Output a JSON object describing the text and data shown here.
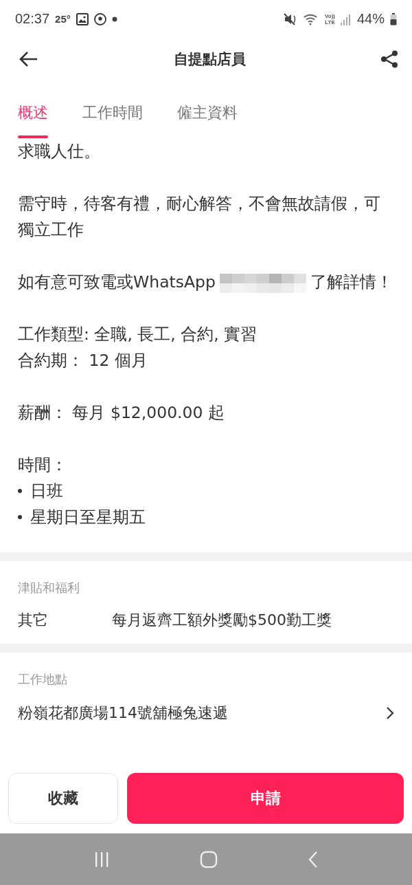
{
  "status_bar": {
    "time": "02:37",
    "temperature": "25°",
    "volte_top": "Vo))",
    "volte_bottom": "LTE",
    "battery": "44%"
  },
  "header": {
    "title": "自提點店員"
  },
  "tabs": [
    {
      "label": "概述",
      "selected": true
    },
    {
      "label": "工作時間",
      "selected": false
    },
    {
      "label": "僱主資料",
      "selected": false
    }
  ],
  "description": [
    {
      "lines": [
        {
          "kind": "text",
          "text": "求職人仕。"
        }
      ]
    },
    {
      "lines": [
        {
          "kind": "text",
          "text": "需守時，待客有禮，耐心解答，不會無故請假，可獨立工作"
        }
      ]
    },
    {
      "lines": [
        {
          "kind": "contact",
          "text": "如有意可致電或WhatsApp",
          "text_after": "了解詳情！"
        }
      ]
    },
    {
      "lines": [
        {
          "kind": "text",
          "text": "工作類型: 全職, 長工, 合約, 實習"
        },
        {
          "kind": "text",
          "text": "合約期： 12 個月"
        }
      ]
    },
    {
      "lines": [
        {
          "kind": "text",
          "text": "薪酬： 每月 $12,000.00 起"
        }
      ]
    },
    {
      "lines": [
        {
          "kind": "text",
          "text": "時間："
        },
        {
          "kind": "bullet",
          "text": "日班"
        },
        {
          "kind": "bullet",
          "text": "星期日至星期五"
        }
      ]
    }
  ],
  "benefits": {
    "label": "津貼和福利",
    "rows": [
      {
        "name": "其它",
        "value": "每月返齊工額外獎勵$500勤工獎"
      }
    ]
  },
  "location": {
    "label": "工作地點",
    "address": "粉嶺花都廣場114號舖極兔速遞"
  },
  "buttons": [
    {
      "kind": "secondary",
      "label": "收藏"
    },
    {
      "kind": "primary",
      "label": "申請"
    }
  ]
}
